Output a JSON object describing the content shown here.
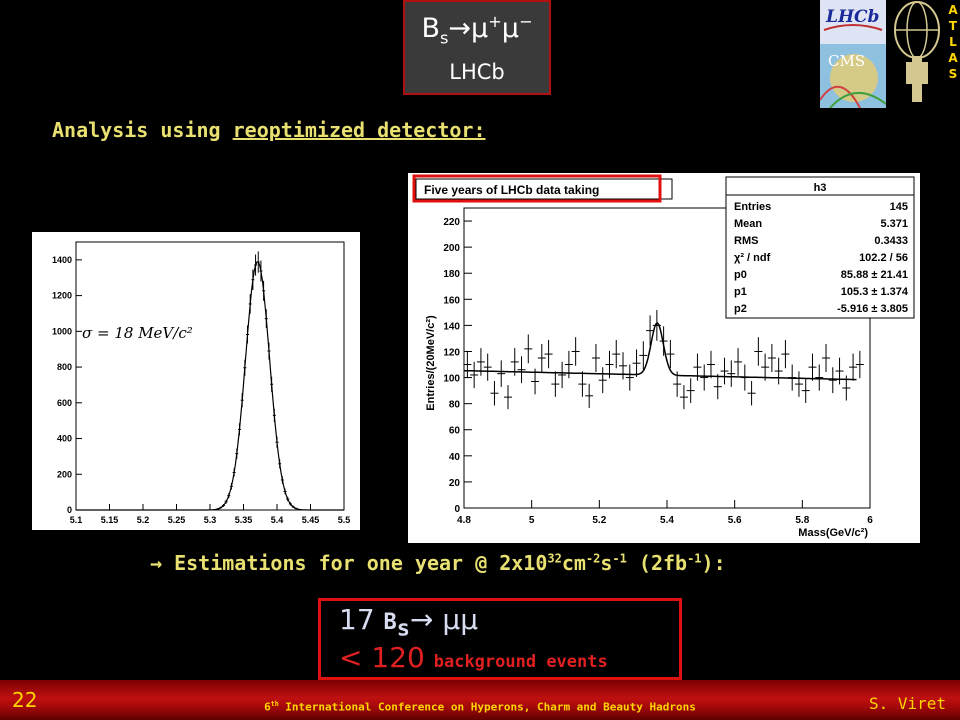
{
  "title": {
    "process_b": "B",
    "process_s": "s",
    "process_arrow": "→",
    "process_mu1": "μ",
    "process_plus": "+",
    "process_mu2": "μ",
    "process_minus": "−",
    "experiment": "LHCb"
  },
  "logos": {
    "lhcb": "LHCb",
    "cms": "CMS",
    "atlas_letters": [
      "A",
      "T",
      "L",
      "A",
      "S"
    ]
  },
  "analysis": {
    "prefix": "Analysis using ",
    "underlined": "reoptimized detector:"
  },
  "left_plot": {
    "sigma_label": "σ = 18 MeV/c²",
    "chart_data": {
      "type": "scatter",
      "x_ticks": [
        "5.1",
        "5.15",
        "5.2",
        "5.25",
        "5.3",
        "5.35",
        "5.4",
        "5.45",
        "5.5"
      ],
      "y_ticks": [
        "0",
        "200",
        "400",
        "600",
        "800",
        "1000",
        "1200",
        "1400"
      ],
      "xlim": [
        5.1,
        5.5
      ],
      "ylim": [
        0,
        1500
      ],
      "peak_mean": 5.371,
      "peak_sigma": 0.018,
      "peak_height": 1390,
      "annotation": "σ = 18 MeV/c²"
    }
  },
  "right_plot": {
    "title": "Five years of LHCb data taking",
    "stats_title": "h3",
    "stats": [
      {
        "k": "Entries",
        "v": "145"
      },
      {
        "k": "Mean",
        "v": "5.371"
      },
      {
        "k": "RMS",
        "v": "0.3433"
      },
      {
        "k": "χ² / ndf",
        "v": "102.2 / 56"
      },
      {
        "k": "p0",
        "v": "85.88 ± 21.41"
      },
      {
        "k": "p1",
        "v": "105.3 ± 1.374"
      },
      {
        "k": "p2",
        "v": "-5.916 ± 3.805"
      }
    ],
    "chart_data": {
      "type": "scatter",
      "title": "Five years of LHCb data taking",
      "xlabel": "Mass(GeV/c²)",
      "ylabel": "Entries/(20MeV/c²)",
      "x_ticks": [
        "4.8",
        "5",
        "5.2",
        "5.4",
        "5.6",
        "5.8",
        "6"
      ],
      "y_ticks": [
        "0",
        "20",
        "40",
        "60",
        "80",
        "100",
        "120",
        "140",
        "160",
        "180",
        "200",
        "220"
      ],
      "xlim": [
        4.8,
        6.0
      ],
      "ylim": [
        0,
        230
      ],
      "fit": {
        "p0": 85.88,
        "p1": 105.3,
        "p2": -5.916,
        "peak_mean": 5.371,
        "peak_sigma": 0.018,
        "background_slope_per_gev": -5.916
      },
      "points": [
        {
          "x": 4.81,
          "y": 110
        },
        {
          "x": 4.83,
          "y": 102
        },
        {
          "x": 4.85,
          "y": 112
        },
        {
          "x": 4.87,
          "y": 108
        },
        {
          "x": 4.89,
          "y": 88
        },
        {
          "x": 4.91,
          "y": 103
        },
        {
          "x": 4.93,
          "y": 85
        },
        {
          "x": 4.95,
          "y": 112
        },
        {
          "x": 4.97,
          "y": 106
        },
        {
          "x": 4.99,
          "y": 122
        },
        {
          "x": 5.01,
          "y": 97
        },
        {
          "x": 5.03,
          "y": 115
        },
        {
          "x": 5.05,
          "y": 118
        },
        {
          "x": 5.07,
          "y": 95
        },
        {
          "x": 5.09,
          "y": 102
        },
        {
          "x": 5.11,
          "y": 110
        },
        {
          "x": 5.13,
          "y": 120
        },
        {
          "x": 5.15,
          "y": 95
        },
        {
          "x": 5.17,
          "y": 86
        },
        {
          "x": 5.19,
          "y": 115
        },
        {
          "x": 5.21,
          "y": 98
        },
        {
          "x": 5.23,
          "y": 110
        },
        {
          "x": 5.25,
          "y": 118
        },
        {
          "x": 5.27,
          "y": 109
        },
        {
          "x": 5.29,
          "y": 100
        },
        {
          "x": 5.31,
          "y": 111
        },
        {
          "x": 5.33,
          "y": 117
        },
        {
          "x": 5.35,
          "y": 136
        },
        {
          "x": 5.37,
          "y": 140
        },
        {
          "x": 5.39,
          "y": 128
        },
        {
          "x": 5.41,
          "y": 118
        },
        {
          "x": 5.43,
          "y": 95
        },
        {
          "x": 5.45,
          "y": 85
        },
        {
          "x": 5.47,
          "y": 90
        },
        {
          "x": 5.49,
          "y": 108
        },
        {
          "x": 5.51,
          "y": 100
        },
        {
          "x": 5.53,
          "y": 110
        },
        {
          "x": 5.55,
          "y": 93
        },
        {
          "x": 5.57,
          "y": 105
        },
        {
          "x": 5.59,
          "y": 103
        },
        {
          "x": 5.61,
          "y": 112
        },
        {
          "x": 5.63,
          "y": 100
        },
        {
          "x": 5.65,
          "y": 88
        },
        {
          "x": 5.67,
          "y": 120
        },
        {
          "x": 5.69,
          "y": 108
        },
        {
          "x": 5.71,
          "y": 115
        },
        {
          "x": 5.73,
          "y": 105
        },
        {
          "x": 5.75,
          "y": 118
        },
        {
          "x": 5.77,
          "y": 100
        },
        {
          "x": 5.79,
          "y": 95
        },
        {
          "x": 5.81,
          "y": 90
        },
        {
          "x": 5.83,
          "y": 108
        },
        {
          "x": 5.85,
          "y": 100
        },
        {
          "x": 5.87,
          "y": 115
        },
        {
          "x": 5.89,
          "y": 98
        },
        {
          "x": 5.91,
          "y": 105
        },
        {
          "x": 5.93,
          "y": 92
        },
        {
          "x": 5.95,
          "y": 108
        },
        {
          "x": 5.97,
          "y": 110
        }
      ]
    }
  },
  "estimation": {
    "arrow": "→",
    "text1": " Estimations for one year @ 2x10",
    "exp1": "32",
    "text2": "cm",
    "exp2": "-2",
    "text3": "s",
    "exp3": "-1",
    "text4": " (2fb",
    "exp4": "-1",
    "text5": "):"
  },
  "result": {
    "count": "17",
    "b": "B",
    "s": "s",
    "arrow": "→",
    "mumu": "μμ",
    "lt": "<",
    "bkg_count": "120",
    "bkg_label": "background events"
  },
  "footer": {
    "page_number": "22",
    "conf_sup": "th",
    "conf_num": "6",
    "conference": " International Conference on Hyperons, Charm and Beauty Hadrons",
    "author": "S. Viret"
  }
}
